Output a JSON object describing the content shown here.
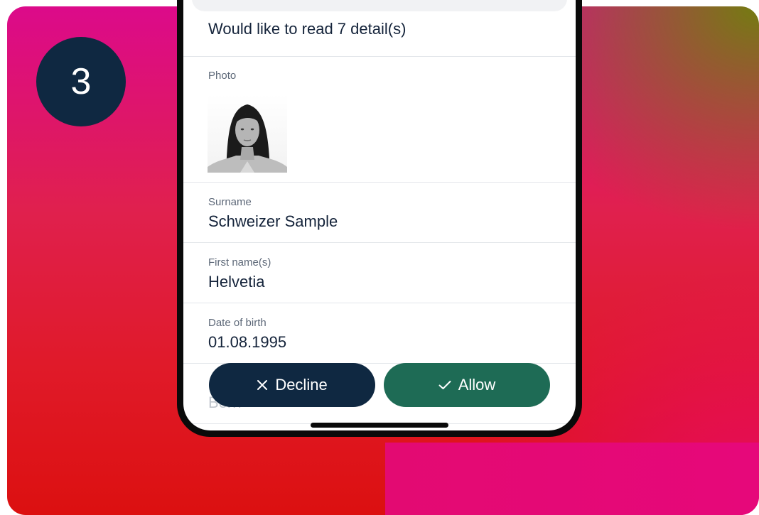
{
  "step": {
    "number": "3"
  },
  "request": {
    "header": "Would like to read 7 detail(s)",
    "photo_label": "Photo",
    "fields": [
      {
        "label": "Surname",
        "value": "Schweizer Sample"
      },
      {
        "label": "First name(s)",
        "value": "Helvetia"
      },
      {
        "label": "Date of birth",
        "value": "01.08.1995"
      }
    ],
    "partial_next_value": "Bern"
  },
  "actions": {
    "decline_label": "Decline",
    "decline_icon": "close-icon",
    "allow_label": "Allow",
    "allow_icon": "checkmark-icon"
  },
  "colors": {
    "badge": "#0f2841",
    "decline_button": "#0f2841",
    "allow_button": "#1e6b55",
    "background_magenta": "#dc0a8a",
    "background_red": "#dc1010",
    "background_olive": "#6e820a"
  }
}
